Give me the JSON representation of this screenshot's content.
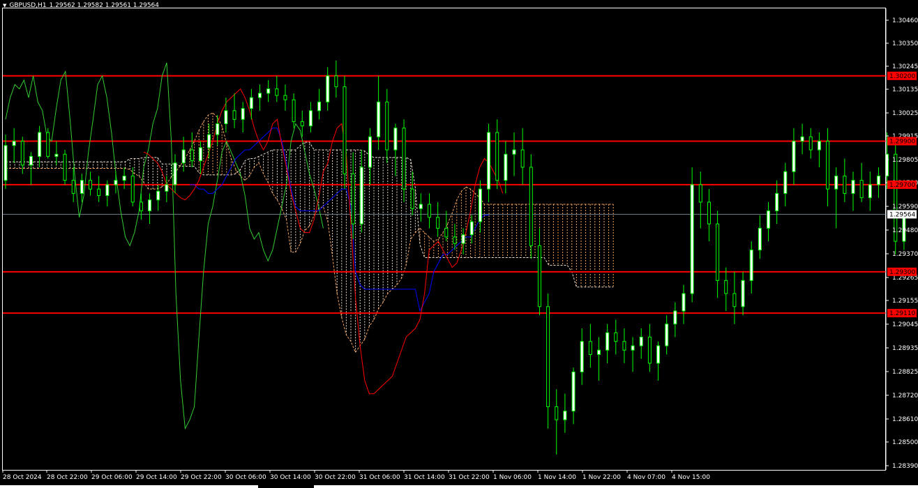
{
  "window": {
    "symbol_label": "GBPUSD,H1",
    "ohlc": "1.29562 1.29582 1.29561 1.29564"
  },
  "colors": {
    "background": "#000000",
    "bull_candle": "#ffffff",
    "bear_candle": "#000000",
    "candle_outline": "#00ff00",
    "tenkan": "#ff0000",
    "kijun": "#0000ff",
    "chikou": "#32cd32",
    "senkou_a": "#f4a460",
    "senkou_b": "#f0e0d0",
    "horizontal_line": "#ff0000",
    "current_price_line": "#708090",
    "axis_text": "#ffffff"
  },
  "chart_data": {
    "type": "candlestick",
    "title": "",
    "symbol": "GBPUSD",
    "timeframe": "H1",
    "y_range": [
      1.2839,
      1.3051
    ],
    "y_ticks": [
      "1.30460",
      "1.30350",
      "1.30245",
      "1.30135",
      "1.30025",
      "1.29915",
      "1.29805",
      "1.29700",
      "1.29590",
      "1.29480",
      "1.29370",
      "1.29265",
      "1.29155",
      "1.29045",
      "1.28935",
      "1.28825",
      "1.28720",
      "1.28610",
      "1.28500",
      "1.28390"
    ],
    "x_ticks": [
      "28 Oct 2024",
      "28 Oct 22:00",
      "29 Oct 06:00",
      "29 Oct 14:00",
      "29 Oct 22:00",
      "30 Oct 06:00",
      "30 Oct 14:00",
      "30 Oct 22:00",
      "31 Oct 06:00",
      "31 Oct 14:00",
      "31 Oct 22:00",
      "1 Nov 06:00",
      "1 Nov 14:00",
      "1 Nov 22:00",
      "4 Nov 07:00",
      "4 Nov 15:00"
    ],
    "horizontal_levels": [
      {
        "price": 1.302,
        "label": "1.30200"
      },
      {
        "price": 1.299,
        "label": "1.29900"
      },
      {
        "price": 1.297,
        "label": "1.29700"
      },
      {
        "price": 1.293,
        "label": "1.29300"
      },
      {
        "price": 1.2911,
        "label": "1.29110"
      }
    ],
    "current_price": {
      "price": 1.29564,
      "label": "1.29564"
    },
    "candles": [
      [
        1.2972,
        1.2993,
        1.2968,
        1.2988
      ],
      [
        1.2988,
        1.2996,
        1.298,
        1.299
      ],
      [
        1.299,
        1.2992,
        1.2975,
        1.2979
      ],
      [
        1.2979,
        1.2985,
        1.297,
        1.2983
      ],
      [
        1.2983,
        1.2997,
        1.2978,
        1.2994
      ],
      [
        1.2994,
        1.2996,
        1.2982,
        1.2983
      ],
      [
        1.2983,
        1.299,
        1.2979,
        1.2984
      ],
      [
        1.2984,
        1.2986,
        1.297,
        1.2972
      ],
      [
        1.2972,
        1.2978,
        1.2962,
        1.2966
      ],
      [
        1.2966,
        1.2975,
        1.2962,
        1.2972
      ],
      [
        1.2972,
        1.2976,
        1.2965,
        1.2968
      ],
      [
        1.2968,
        1.2974,
        1.2962,
        1.2965
      ],
      [
        1.2965,
        1.2972,
        1.296,
        1.297
      ],
      [
        1.297,
        1.2976,
        1.2966,
        1.2972
      ],
      [
        1.2972,
        1.2978,
        1.2968,
        1.2974
      ],
      [
        1.2974,
        1.2978,
        1.296,
        1.2962
      ],
      [
        1.2962,
        1.2966,
        1.2954,
        1.2958
      ],
      [
        1.2958,
        1.2966,
        1.2952,
        1.2963
      ],
      [
        1.2963,
        1.297,
        1.2958,
        1.2967
      ],
      [
        1.2967,
        1.2974,
        1.2962,
        1.297
      ],
      [
        1.297,
        1.2984,
        1.2966,
        1.298
      ],
      [
        1.298,
        1.2992,
        1.2976,
        1.2986
      ],
      [
        1.2986,
        1.2994,
        1.2978,
        1.2981
      ],
      [
        1.2981,
        1.299,
        1.2975,
        1.2987
      ],
      [
        1.2987,
        1.2998,
        1.2982,
        1.2993
      ],
      [
        1.2993,
        1.3002,
        1.2988,
        1.2998
      ],
      [
        1.2998,
        1.301,
        1.2994,
        1.3004
      ],
      [
        1.3004,
        1.3012,
        1.2996,
        1.3
      ],
      [
        1.3,
        1.3008,
        1.2994,
        1.3005
      ],
      [
        1.3005,
        1.3014,
        1.3,
        1.301
      ],
      [
        1.301,
        1.3016,
        1.3004,
        1.3012
      ],
      [
        1.3012,
        1.3018,
        1.3008,
        1.3014
      ],
      [
        1.3014,
        1.302,
        1.3008,
        1.3011
      ],
      [
        1.3011,
        1.3016,
        1.3004,
        1.3009
      ],
      [
        1.3009,
        1.3012,
        1.2996,
        1.2999
      ],
      [
        1.2999,
        1.3004,
        1.2992,
        1.2997
      ],
      [
        1.2997,
        1.3008,
        1.2994,
        1.3004
      ],
      [
        1.3004,
        1.3014,
        1.3,
        1.3008
      ],
      [
        1.3008,
        1.3024,
        1.3004,
        1.302
      ],
      [
        1.302,
        1.3027,
        1.301,
        1.3015
      ],
      [
        1.3015,
        1.302,
        1.2968,
        1.2975
      ],
      [
        1.2975,
        1.2985,
        1.2945,
        1.2952
      ],
      [
        1.2952,
        1.2986,
        1.2948,
        1.2978
      ],
      [
        1.2978,
        1.2996,
        1.297,
        1.2992
      ],
      [
        1.2992,
        1.302,
        1.2986,
        1.3008
      ],
      [
        1.3008,
        1.3014,
        1.298,
        1.2986
      ],
      [
        1.2986,
        1.2998,
        1.2974,
        1.2996
      ],
      [
        1.2996,
        1.3,
        1.2962,
        1.2968
      ],
      [
        1.2968,
        1.2976,
        1.2956,
        1.2959
      ],
      [
        1.2959,
        1.2966,
        1.2953,
        1.2961
      ],
      [
        1.2961,
        1.2966,
        1.295,
        1.2955
      ],
      [
        1.2955,
        1.2962,
        1.2946,
        1.295
      ],
      [
        1.295,
        1.2958,
        1.2944,
        1.2946
      ],
      [
        1.2946,
        1.2952,
        1.294,
        1.2943
      ],
      [
        1.2943,
        1.295,
        1.2938,
        1.2947
      ],
      [
        1.2947,
        1.2956,
        1.2943,
        1.2953
      ],
      [
        1.2953,
        1.2972,
        1.2948,
        1.2968
      ],
      [
        1.2968,
        1.2998,
        1.2962,
        1.2994
      ],
      [
        1.2994,
        1.3,
        1.2968,
        1.2972
      ],
      [
        1.2972,
        1.299,
        1.2966,
        1.2984
      ],
      [
        1.2984,
        1.2994,
        1.2974,
        1.2986
      ],
      [
        1.2986,
        1.2996,
        1.297,
        1.2978
      ],
      [
        1.2978,
        1.2984,
        1.2936,
        1.2942
      ],
      [
        1.2942,
        1.295,
        1.291,
        1.2914
      ],
      [
        1.2914,
        1.292,
        1.2858,
        1.2868
      ],
      [
        1.2868,
        1.2876,
        1.2846,
        1.2862
      ],
      [
        1.2862,
        1.2874,
        1.2856,
        1.2866
      ],
      [
        1.2866,
        1.2886,
        1.286,
        1.2884
      ],
      [
        1.2884,
        1.2904,
        1.2878,
        1.2898
      ],
      [
        1.2898,
        1.2906,
        1.2886,
        1.2892
      ],
      [
        1.2892,
        1.29,
        1.288,
        1.2894
      ],
      [
        1.2894,
        1.2906,
        1.2888,
        1.2902
      ],
      [
        1.2902,
        1.2908,
        1.2892,
        1.2898
      ],
      [
        1.2898,
        1.2904,
        1.2888,
        1.2894
      ],
      [
        1.2894,
        1.29,
        1.2884,
        1.2896
      ],
      [
        1.2896,
        1.2904,
        1.289,
        1.29
      ],
      [
        1.29,
        1.2906,
        1.2884,
        1.2888
      ],
      [
        1.2888,
        1.2898,
        1.288,
        1.2896
      ],
      [
        1.2896,
        1.291,
        1.2892,
        1.2906
      ],
      [
        1.2906,
        1.2916,
        1.29,
        1.2912
      ],
      [
        1.2912,
        1.2924,
        1.2906,
        1.292
      ],
      [
        1.292,
        1.2978,
        1.2916,
        1.297
      ],
      [
        1.297,
        1.2976,
        1.295,
        1.2962
      ],
      [
        1.2962,
        1.2968,
        1.2944,
        1.2952
      ],
      [
        1.2952,
        1.2958,
        1.2918,
        1.2926
      ],
      [
        1.2926,
        1.2932,
        1.2912,
        1.292
      ],
      [
        1.292,
        1.293,
        1.2906,
        1.2914
      ],
      [
        1.2914,
        1.293,
        1.291,
        1.2926
      ],
      [
        1.2926,
        1.2944,
        1.292,
        1.294
      ],
      [
        1.294,
        1.2956,
        1.2936,
        1.295
      ],
      [
        1.295,
        1.2962,
        1.2944,
        1.2958
      ],
      [
        1.2958,
        1.2972,
        1.2952,
        1.2966
      ],
      [
        1.2966,
        1.298,
        1.296,
        1.2976
      ],
      [
        1.2976,
        1.2996,
        1.297,
        1.299
      ],
      [
        1.299,
        1.2998,
        1.2984,
        1.2992
      ],
      [
        1.2992,
        1.2996,
        1.2982,
        1.2986
      ],
      [
        1.2986,
        1.2994,
        1.2978,
        1.299
      ],
      [
        1.299,
        1.2996,
        1.296,
        1.2968
      ],
      [
        1.2968,
        1.2978,
        1.295,
        1.2974
      ],
      [
        1.2974,
        1.2982,
        1.2962,
        1.2966
      ],
      [
        1.2966,
        1.2976,
        1.2958,
        1.2972
      ],
      [
        1.2972,
        1.298,
        1.2962,
        1.2964
      ],
      [
        1.2964,
        1.2976,
        1.2958,
        1.297
      ],
      [
        1.297,
        1.2978,
        1.2964,
        1.2974
      ],
      [
        1.2974,
        1.2994,
        1.2968,
        1.2984
      ],
      [
        1.2984,
        1.299,
        1.2938,
        1.2944
      ],
      [
        1.2944,
        1.2958,
        1.294,
        1.2956
      ]
    ],
    "tenkan": [
      1.2985,
      1.2984,
      1.2982,
      1.298,
      1.2976,
      1.297,
      1.2968,
      1.2966,
      1.2964,
      1.2963,
      1.2965,
      1.2968,
      1.2972,
      1.2978,
      1.2984,
      1.299,
      1.2998,
      1.3004,
      1.3008,
      1.301,
      1.3012,
      1.3014,
      1.301,
      1.3004,
      1.2996,
      1.299,
      1.2986,
      1.299,
      1.2998,
      1.3,
      1.2988,
      1.2978,
      1.2966,
      1.2958,
      1.295,
      1.2948,
      1.2948,
      1.2954,
      1.2964,
      1.2976,
      1.298,
      1.299,
      1.2996,
      1.2998,
      1.2984,
      1.2952,
      1.2918,
      1.2896,
      1.288,
      1.2874,
      1.2874,
      1.2876,
      1.2878,
      1.288,
      1.2882,
      1.2888,
      1.2894,
      1.29,
      1.2902,
      1.2904,
      1.2908,
      1.292,
      1.294,
      1.2942,
      1.2944,
      1.294,
      1.2936,
      1.2932,
      1.2934,
      1.294,
      1.2948,
      1.2958,
      1.297,
      1.2978,
      1.2982,
      1.298,
      1.2976,
      1.2972,
      1.2966
    ],
    "kijun": [
      1.297,
      1.297,
      1.2968,
      1.2968,
      1.2966,
      1.2966,
      1.2968,
      1.297,
      1.2974,
      1.2978,
      1.2982,
      1.2984,
      1.2986,
      1.2986,
      1.2988,
      1.299,
      1.2992,
      1.2994,
      1.2996,
      1.2996,
      1.299,
      1.298,
      1.2968,
      1.296,
      1.2958,
      1.2958,
      1.2958,
      1.2958,
      1.2958,
      1.296,
      1.2962,
      1.2964,
      1.2966,
      1.2968,
      1.2968,
      1.296,
      1.293,
      1.2924,
      1.2922,
      1.2922,
      1.2922,
      1.2922,
      1.2922,
      1.2922,
      1.2922,
      1.2922,
      1.2922,
      1.2922,
      1.2922,
      1.2922,
      1.2912,
      1.2916,
      1.292,
      1.293,
      1.2934,
      1.2938,
      1.2938,
      1.294,
      1.2942,
      1.2944,
      1.2946,
      1.2946,
      1.295,
      1.2954,
      1.2956,
      1.2956
    ],
    "chikou": [
      1.3,
      1.301,
      1.3016,
      1.3014,
      1.3018,
      1.301,
      1.302,
      1.3008,
      1.3004,
      1.2992,
      1.299,
      1.3005,
      1.3018,
      1.3022,
      1.3,
      1.2975,
      1.2955,
      1.2965,
      1.2985,
      1.3,
      1.3016,
      1.302,
      1.301,
      1.2994,
      1.2974,
      1.2958,
      1.2946,
      1.2942,
      1.2948,
      1.2958,
      1.2978,
      1.2986,
      1.2998,
      1.3005,
      1.302,
      1.3026,
      1.299,
      1.292,
      1.288,
      1.2858,
      1.2862,
      1.2868,
      1.29,
      1.293,
      1.2952,
      1.296,
      1.2972,
      1.2985,
      1.299,
      1.2985,
      1.298,
      1.2975,
      1.2965,
      1.295,
      1.2945,
      1.2948,
      1.294,
      1.2935,
      1.294,
      1.295,
      1.296,
      1.297,
      1.299,
      1.2998,
      1.2995,
      1.2985,
      1.2975,
      1.2968,
      1.296,
      1.295
    ]
  }
}
